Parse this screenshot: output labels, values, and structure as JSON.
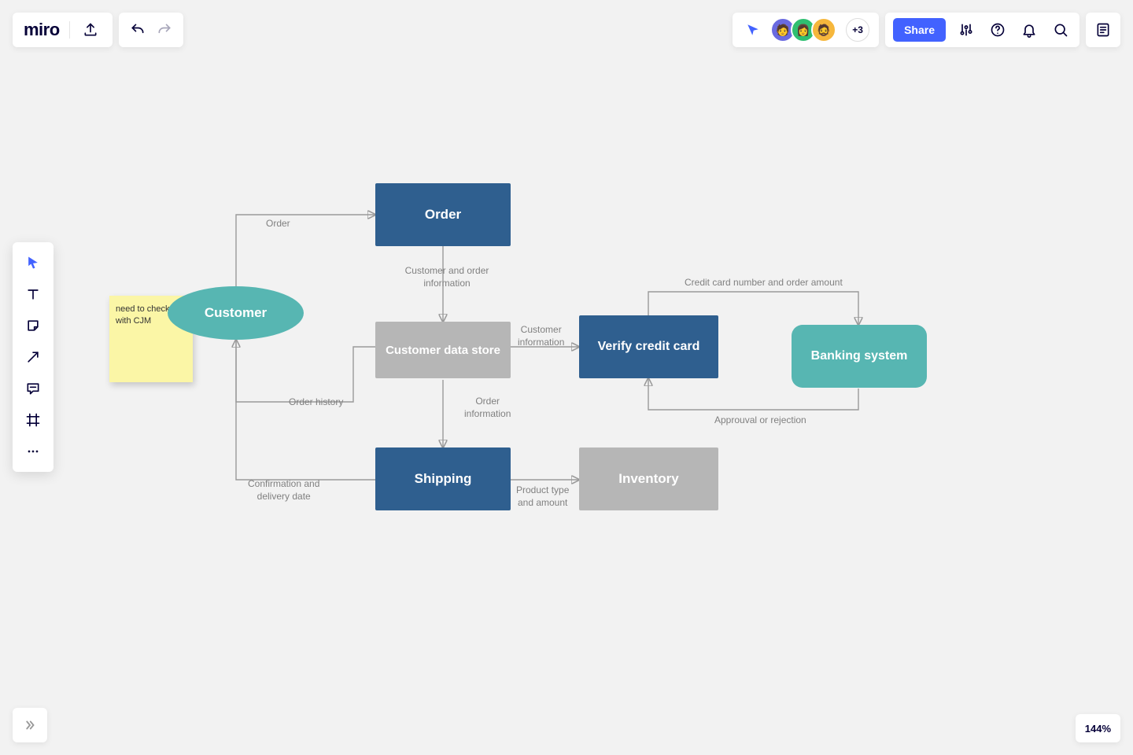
{
  "app": {
    "logo": "miro"
  },
  "header": {
    "share_label": "Share",
    "more_avatars": "+3"
  },
  "zoom": {
    "level": "144%"
  },
  "sticky": {
    "text": "need to check with CJM"
  },
  "nodes": {
    "customer": "Customer",
    "order": "Order",
    "cds": "Customer data store",
    "verify": "Verify credit card",
    "banking": "Banking system",
    "shipping": "Shipping",
    "inventory": "Inventory"
  },
  "edges": {
    "e_order": "Order",
    "e_cust_order_info": "Customer and order\ninformation",
    "e_cust_info": "Customer\ninformation",
    "e_cc_amount": "Credit card number and order amount",
    "e_approval": "Approuval or rejection",
    "e_order_info": "Order\ninformation",
    "e_order_history": "Order history",
    "e_confirm": "Confirmation and\ndelivery date",
    "e_product": "Product type\nand amount"
  },
  "colors": {
    "blue": "#2f5f8f",
    "gray": "#b6b6b6",
    "teal": "#57b6b2",
    "sticky": "#fbf6a6",
    "accent": "#4262ff"
  }
}
